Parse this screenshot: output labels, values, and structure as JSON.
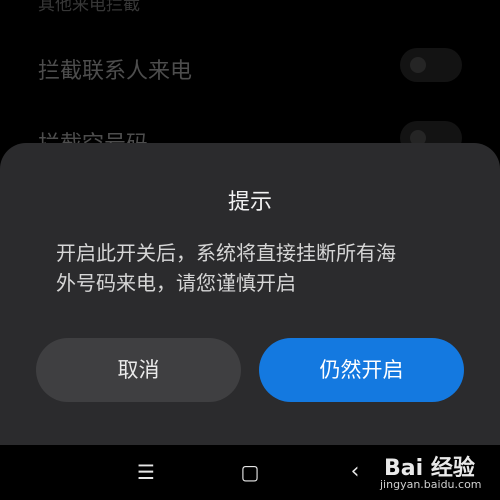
{
  "settings": {
    "section_header": "其他来电拦截",
    "rows": [
      {
        "label": "拦截联系人来电",
        "enabled": false
      },
      {
        "label": "拦截空号码",
        "enabled": false
      }
    ]
  },
  "dialog": {
    "title": "提示",
    "message_line1": "开启此开关后，系统将直接挂断所有海",
    "message_line2": "外号码来电，请您谨慎开启",
    "cancel_label": "取消",
    "confirm_label": "仍然开启",
    "accent_color": "#1479e0"
  },
  "navbar": {
    "recent_icon": "☰",
    "home_icon": "▢",
    "back_icon": "‹"
  },
  "watermark": {
    "brand": "Bai 经验",
    "url": "jingyan.baidu.com"
  }
}
